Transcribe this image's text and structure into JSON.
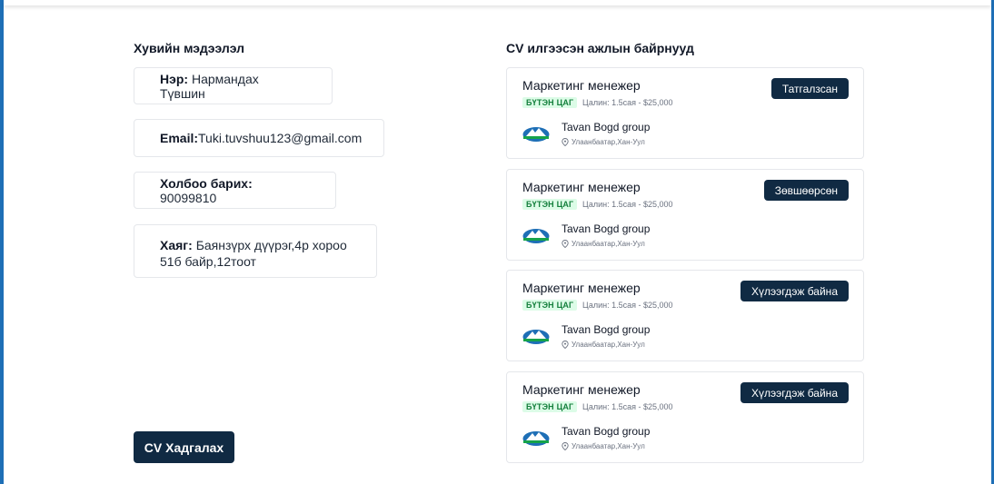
{
  "personal": {
    "title": "Хувийн мэдээлэл",
    "name_label": "Нэр:",
    "name_value": "Нармандах Түвшин",
    "email_label": "Email:",
    "email_value": "Tuki.tuvshuu123@gmail.com",
    "phone_label": "Холбоо барих:",
    "phone_value": "90099810",
    "address_label": "Хаяг:",
    "address_value_line1": "Баянзүрх дүүрэг,4р хороо",
    "address_value_line2": "51б байр,12тоот"
  },
  "save_button": "CV Хадгалах",
  "jobs": {
    "title": "CV илгээсэн ажлын байрнууд",
    "items": [
      {
        "title": "Маркетинг менежер",
        "type": "БҮТЭН ЦАГ",
        "salary": "Цалин: 1.5сая - $25,000",
        "company": "Tavan Bogd group",
        "location": "Улаанбаатар,Хан-Уул",
        "status": "Татгалзсан"
      },
      {
        "title": "Маркетинг менежер",
        "type": "БҮТЭН ЦАГ",
        "salary": "Цалин: 1.5сая - $25,000",
        "company": "Tavan Bogd group",
        "location": "Улаанбаатар,Хан-Уул",
        "status": "Зөвшөөрсөн"
      },
      {
        "title": "Маркетинг менежер",
        "type": "БҮТЭН ЦАГ",
        "salary": "Цалин: 1.5сая - $25,000",
        "company": "Tavan Bogd group",
        "location": "Улаанбаатар,Хан-Уул",
        "status": "Хүлээгдэж байна"
      },
      {
        "title": "Маркетинг менежер",
        "type": "БҮТЭН ЦАГ",
        "salary": "Цалин: 1.5сая - $25,000",
        "company": "Tavan Bogd group",
        "location": "Улаанбаатар,Хан-Уул",
        "status": "Хүлээгдэж байна"
      }
    ]
  },
  "colors": {
    "primary": "#102a43",
    "accent_frame": "#1e6fb6",
    "type_badge_bg": "#dcfce7",
    "type_badge_text": "#15803d"
  }
}
